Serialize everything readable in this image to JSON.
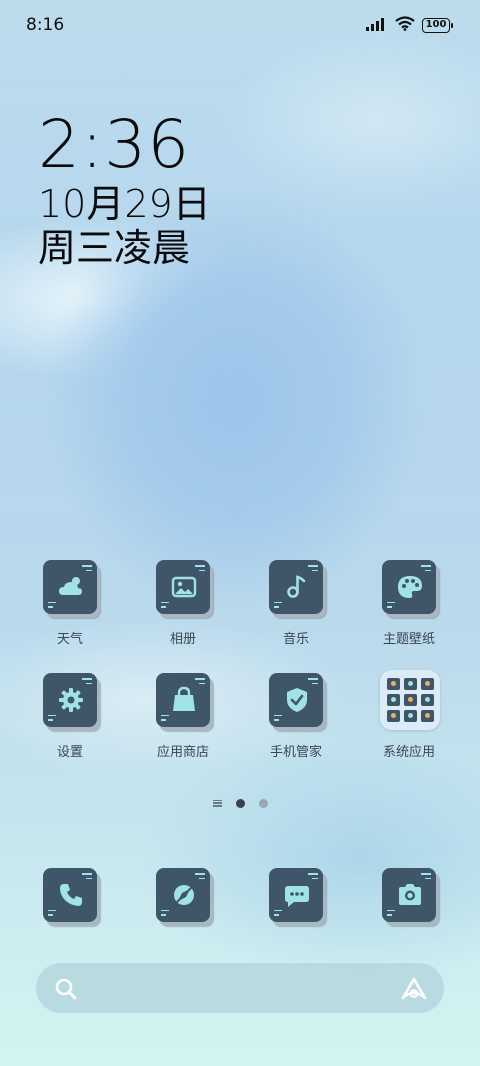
{
  "status_bar": {
    "time": "8:16",
    "battery": "100",
    "icons": [
      "signal-icon",
      "wifi-icon",
      "battery-icon"
    ]
  },
  "clock_widget": {
    "time": "2:36",
    "date": "10月29日",
    "day": "周三凌晨"
  },
  "apps": [
    {
      "name": "app-weather",
      "label": "天气",
      "icon": "weather-icon"
    },
    {
      "name": "app-gallery",
      "label": "相册",
      "icon": "gallery-icon"
    },
    {
      "name": "app-music",
      "label": "音乐",
      "icon": "music-icon"
    },
    {
      "name": "app-themes",
      "label": "主题壁纸",
      "icon": "palette-icon"
    },
    {
      "name": "app-settings",
      "label": "设置",
      "icon": "gear-icon"
    },
    {
      "name": "app-store",
      "label": "应用商店",
      "icon": "shopping-bag-icon"
    },
    {
      "name": "app-security",
      "label": "手机管家",
      "icon": "shield-icon"
    },
    {
      "name": "app-system-folder",
      "label": "系统应用",
      "icon": "folder-icon"
    }
  ],
  "dock": [
    {
      "name": "dock-phone",
      "icon": "phone-icon"
    },
    {
      "name": "dock-browser",
      "icon": "browser-icon"
    },
    {
      "name": "dock-messages",
      "icon": "message-icon"
    },
    {
      "name": "dock-camera",
      "icon": "camera-icon"
    }
  ],
  "page_indicator": {
    "pages": 2,
    "active": 1
  },
  "search_bar": {
    "icons": [
      "search-icon",
      "ai-assistant-icon"
    ]
  },
  "colors": {
    "icon_card": "#3f5668",
    "icon_accent": "#9fe3e6",
    "text": "#3a4652"
  }
}
